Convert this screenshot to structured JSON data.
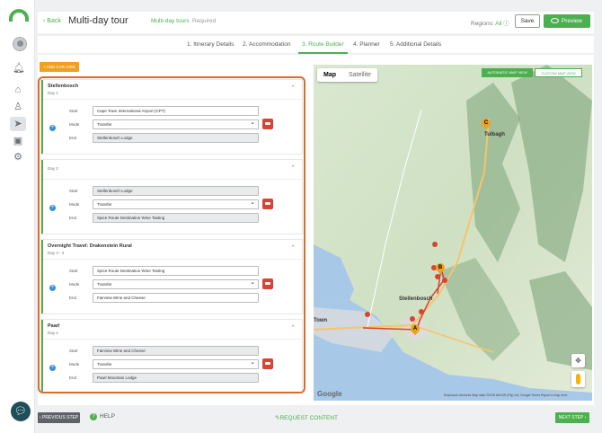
{
  "sidebar": {
    "icons": [
      "logo-icon",
      "avatar",
      "bell-icon",
      "home-icon",
      "users-icon",
      "send-icon",
      "image-icon",
      "settings-icon"
    ]
  },
  "header": {
    "back_label": "Back",
    "title": "Multi-day tour",
    "breadcrumb_link": "Multi-day tours",
    "breadcrumb_current": "Required",
    "regions_label": "Regions:",
    "regions_value": "All",
    "save_label": "Save",
    "preview_label": "Preview"
  },
  "steps": [
    {
      "label": "1. Itinerary Details"
    },
    {
      "label": "2. Accommodation"
    },
    {
      "label": "3. Route Builder",
      "active": true
    },
    {
      "label": "4. Planner"
    },
    {
      "label": "5. Additional Details"
    }
  ],
  "add_car_hire_label": "+ ADD CAR HIRE",
  "labels": {
    "start": "Start",
    "mode": "Mode",
    "end": "End"
  },
  "routes": [
    {
      "title": "Stellenbosch",
      "day": "Day 1",
      "start": "Cape Town International Airport (CPT)",
      "mode": "Transfer",
      "end": "Stellenbosch Lodge"
    },
    {
      "title": "",
      "day": "Day 2",
      "start": "Stellenbosch Lodge",
      "mode": "Transfer",
      "end": "Spice Route Destination Wine Tasting"
    },
    {
      "title": "Overnight Travel: Drakenstein Rural",
      "day": "Day 3 - 4",
      "start": "Spice Route Destination Wine Tasting",
      "mode": "Transfer",
      "end": "Fairview Wine and Cheese"
    },
    {
      "title": "Paarl",
      "day": "Day 4",
      "start": "Fairview Wine and Cheese",
      "mode": "Transfer",
      "end": "Paarl Mountain Lodge"
    }
  ],
  "map": {
    "tab_map": "Map",
    "tab_satellite": "Satellite",
    "auto_view": "AUTOMATIC MAP VIEW",
    "custom_view": "CUSTOM MAP VIEW",
    "google": "Google",
    "attribution": "Keyboard shortcuts   Map data ©2025 AfriGIS (Pty) Ltd, Google   Terms   Report a map error",
    "markers": [
      "C",
      "B",
      "A"
    ],
    "cities": [
      "Tulbagh",
      "Town",
      "Stellenbosch"
    ]
  },
  "footer": {
    "prev_label": "PREVIOUS STEP",
    "help_label": "HELP",
    "request_label": "REQUEST CONTENT",
    "next_label": "NEXT STEP"
  }
}
